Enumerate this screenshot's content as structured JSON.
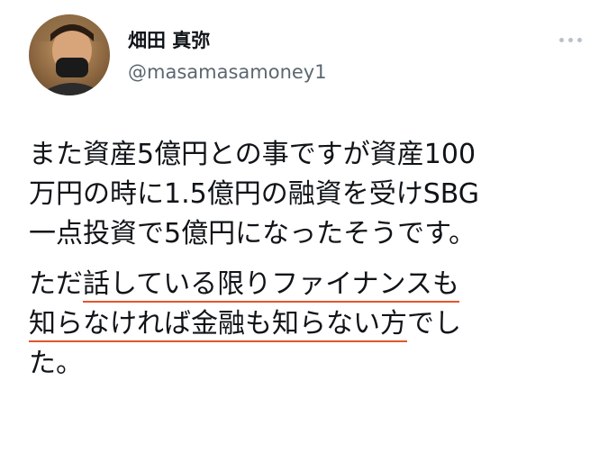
{
  "user": {
    "display_name": "畑田 真弥",
    "handle": "@masamasamoney1"
  },
  "tweet": {
    "paragraph1": [
      "また資産5億円との事ですが資産100",
      "万円の時に1.5億円の融資を受けSBG",
      "一点投資で5億円になったそうです。"
    ],
    "paragraph2": {
      "l1_prefix": "ただ",
      "l1_underlined": "話している限りファイナンスも",
      "l2_underlined": "知らなければ金融も知らない方",
      "l2_suffix": "でし",
      "l3": "た。"
    }
  },
  "icons": {
    "more": "more-options-icon"
  },
  "colors": {
    "text": "#101418",
    "handle": "#5b6770",
    "underline": "#e2562c",
    "dots": "#b9c1c8"
  }
}
